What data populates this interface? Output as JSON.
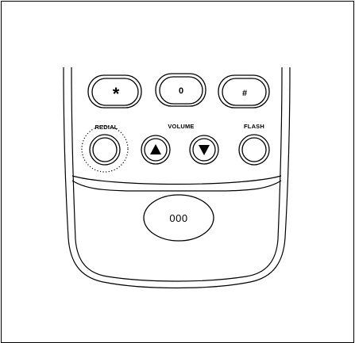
{
  "keypad": {
    "star_key": "*",
    "zero_key": "0",
    "hash_key": "#"
  },
  "labels": {
    "redial": "REDIAL",
    "volume": "VOLUME",
    "flash": "FLASH"
  },
  "speaker": {
    "label": "000"
  },
  "icons": {
    "volume_up": "triangle-up-icon",
    "volume_down": "triangle-down-icon"
  },
  "colors": {
    "line": "#000000",
    "background": "#ffffff"
  }
}
